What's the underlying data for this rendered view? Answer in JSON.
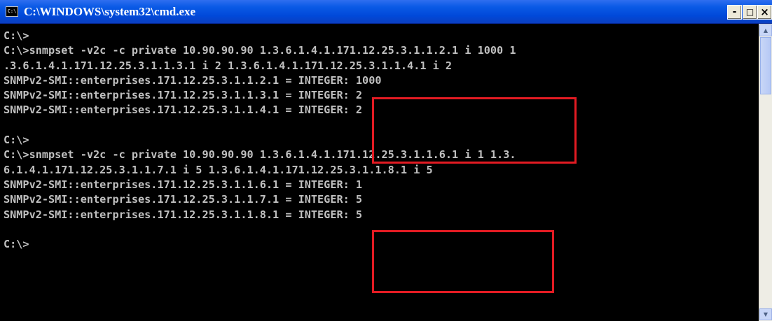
{
  "window": {
    "title": "C:\\WINDOWS\\system32\\cmd.exe",
    "icon_text": "C:\\",
    "minimize_glyph": "-",
    "maximize_glyph": "□",
    "close_glyph": "×"
  },
  "console": {
    "lines": [
      "C:\\>",
      "C:\\>snmpset -v2c -c private 10.90.90.90 1.3.6.1.4.1.171.12.25.3.1.1.2.1 i 1000 1",
      ".3.6.1.4.1.171.12.25.3.1.1.3.1 i 2 1.3.6.1.4.1.171.12.25.3.1.1.4.1 i 2",
      "SNMPv2-SMI::enterprises.171.12.25.3.1.1.2.1 = INTEGER: 1000",
      "SNMPv2-SMI::enterprises.171.12.25.3.1.1.3.1 = INTEGER: 2",
      "SNMPv2-SMI::enterprises.171.12.25.3.1.1.4.1 = INTEGER: 2",
      "",
      "C:\\>",
      "C:\\>snmpset -v2c -c private 10.90.90.90 1.3.6.1.4.1.171.12.25.3.1.1.6.1 i 1 1.3.",
      "6.1.4.1.171.12.25.3.1.1.7.1 i 5 1.3.6.1.4.1.171.12.25.3.1.1.8.1 i 5",
      "SNMPv2-SMI::enterprises.171.12.25.3.1.1.6.1 = INTEGER: 1",
      "SNMPv2-SMI::enterprises.171.12.25.3.1.1.7.1 = INTEGER: 5",
      "SNMPv2-SMI::enterprises.171.12.25.3.1.1.8.1 = INTEGER: 5",
      "",
      "C:\\>"
    ]
  },
  "scrollbar": {
    "up_glyph": "▲",
    "down_glyph": "▼"
  },
  "colors": {
    "console_background": "#000000",
    "console_text": "#c0c0c0",
    "highlight_box": "#e31b23",
    "titlebar": "#0a5ae6"
  }
}
